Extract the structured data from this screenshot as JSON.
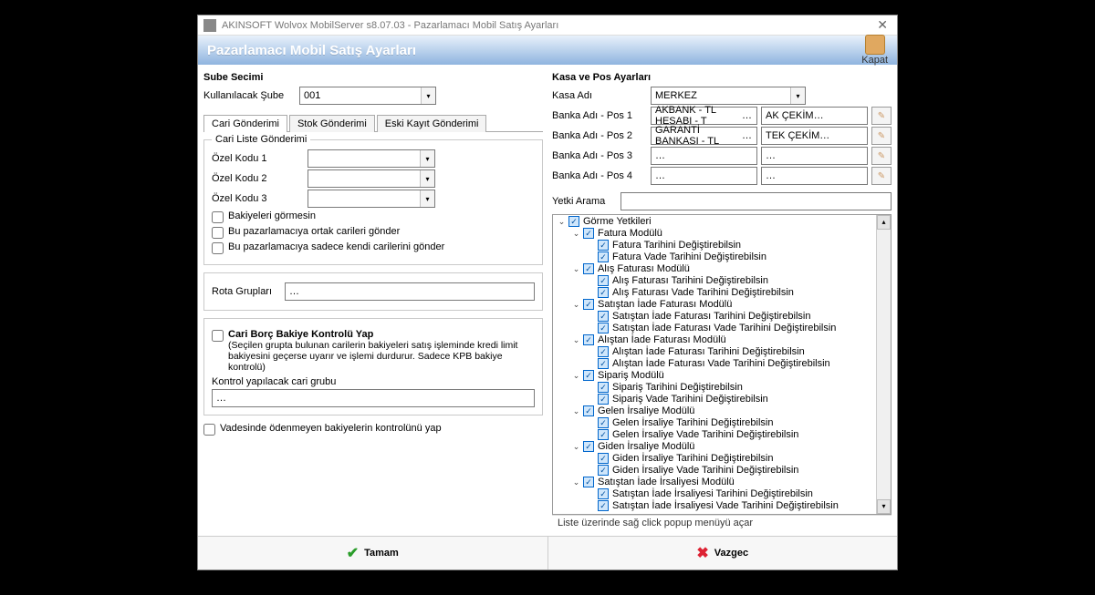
{
  "titlebar": "AKINSOFT Wolvox MobilServer s8.07.03 - Pazarlamacı Mobil Satış Ayarları",
  "banner": {
    "title": "Pazarlamacı Mobil Satış Ayarları",
    "close": "Kapat"
  },
  "left": {
    "sube_secimi": "Sube Secimi",
    "kullanilacak_sube_lbl": "Kullanılacak Şube",
    "kullanilacak_sube_val": "001",
    "tabs": {
      "cari": "Cari Gönderimi",
      "stok": "Stok Gönderimi",
      "eski": "Eski Kayıt Gönderimi"
    },
    "grp_cari_liste": "Cari Liste Gönderimi",
    "ozel1": "Özel Kodu 1",
    "ozel2": "Özel Kodu 2",
    "ozel3": "Özel Kodu 3",
    "chk_bakiye": "Bakiyeleri görmesin",
    "chk_ortak": "Bu pazarlamacıya ortak carileri gönder",
    "chk_kendi": "Bu pazarlamacıya sadece kendi carilerini gönder",
    "rota_lbl": "Rota Grupları",
    "grp_borc_legend": "",
    "chk_borc_title": "Cari Borç Bakiye Kontrolü Yap",
    "chk_borc_desc": "(Seçilen grupta bulunan carilerin bakiyeleri satış işleminde kredi limit bakiyesini geçerse uyarır ve işlemi durdurur. Sadece KPB bakiye kontrolü)",
    "kontrol_grubu_lbl": "Kontrol yapılacak cari grubu",
    "chk_vade": "Vadesinde ödenmeyen bakiyelerin kontrolünü yap"
  },
  "right": {
    "kasa_pos": "Kasa ve Pos Ayarları",
    "kasa_adi_lbl": "Kasa Adı",
    "kasa_adi_val": "MERKEZ",
    "pos": [
      {
        "lbl": "Banka Adı - Pos 1",
        "v1": "AKBANK - TL HESABI - T",
        "v2": "AK ÇEKİM"
      },
      {
        "lbl": "Banka Adı - Pos 2",
        "v1": "GARANTİ BANKASI - TL",
        "v2": "TEK ÇEKİM"
      },
      {
        "lbl": "Banka Adı - Pos 3",
        "v1": "",
        "v2": ""
      },
      {
        "lbl": "Banka Adı - Pos 4",
        "v1": "",
        "v2": ""
      }
    ],
    "yetki_lbl": "Yetki Arama",
    "hint": "Liste üzerinde sağ click popup menüyü açar"
  },
  "tree": [
    {
      "t": "Görme Yetkileri",
      "c": [
        {
          "t": "Fatura Modülü",
          "c": [
            {
              "t": "Fatura Tarihini Değiştirebilsin"
            },
            {
              "t": "Fatura Vade Tarihini Değiştirebilsin"
            }
          ]
        },
        {
          "t": "Alış Faturası Modülü",
          "c": [
            {
              "t": "Alış Faturası Tarihini Değiştirebilsin"
            },
            {
              "t": "Alış Faturası Vade Tarihini Değiştirebilsin"
            }
          ]
        },
        {
          "t": "Satıştan İade Faturası Modülü",
          "c": [
            {
              "t": "Satıştan İade Faturası Tarihini Değiştirebilsin"
            },
            {
              "t": "Satıştan İade Faturası Vade Tarihini Değiştirebilsin"
            }
          ]
        },
        {
          "t": "Alıştan İade Faturası Modülü",
          "c": [
            {
              "t": "Alıştan İade Faturası Tarihini Değiştirebilsin"
            },
            {
              "t": "Alıştan İade Faturası Vade Tarihini Değiştirebilsin"
            }
          ]
        },
        {
          "t": "Sipariş Modülü",
          "c": [
            {
              "t": "Sipariş Tarihini Değiştirebilsin"
            },
            {
              "t": "Sipariş Vade Tarihini Değiştirebilsin"
            }
          ]
        },
        {
          "t": "Gelen İrsaliye Modülü",
          "c": [
            {
              "t": "Gelen İrsaliye Tarihini Değiştirebilsin"
            },
            {
              "t": "Gelen İrsaliye Vade Tarihini Değiştirebilsin"
            }
          ]
        },
        {
          "t": "Giden İrsaliye Modülü",
          "c": [
            {
              "t": "Giden İrsaliye Tarihini Değiştirebilsin"
            },
            {
              "t": "Giden İrsaliye Vade Tarihini Değiştirebilsin"
            }
          ]
        },
        {
          "t": "Satıştan İade İrsaliyesi Modülü",
          "c": [
            {
              "t": "Satıştan İade İrsaliyesi Tarihini Değiştirebilsin"
            },
            {
              "t": "Satıştan İade İrsaliyesi Vade Tarihini Değiştirebilsin"
            }
          ]
        }
      ]
    }
  ],
  "buttons": {
    "ok": "Tamam",
    "cancel": "Vazgec"
  }
}
